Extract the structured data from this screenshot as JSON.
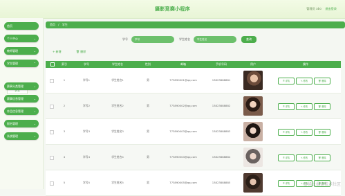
{
  "header": {
    "title": "摄影竞赛小程序",
    "user_label": "管理员 abo",
    "logout_label": "退出登录"
  },
  "sidebar": {
    "items": [
      {
        "label": "首页"
      },
      {
        "label": "个人中心"
      },
      {
        "label": "教师管理"
      },
      {
        "label": "学生管理"
      },
      {
        "label": "赛事分类管理"
      },
      {
        "label": "赛事信息管理"
      },
      {
        "label": "作品信息管理"
      },
      {
        "label": "报名管理"
      },
      {
        "label": "系统管理"
      }
    ],
    "sub_item": "学生"
  },
  "breadcrumb": {
    "home": "首页",
    "sep": "/",
    "current": "学生"
  },
  "search": {
    "field1_label": "学号",
    "field1_placeholder": "学号",
    "field2_label": "学生姓名",
    "field2_placeholder": "学生姓名",
    "button_label": "查询"
  },
  "actions": {
    "add_label": "新增",
    "delete_label": "删除"
  },
  "table": {
    "headers": [
      "",
      "索引",
      "学号",
      "学生姓名",
      "性别",
      "邮箱",
      "手机号码",
      "用户",
      "操作"
    ],
    "rows": [
      {
        "index": "1",
        "sid": "学号1",
        "name": "学生姓名1",
        "gender": "男",
        "email": "773890001@qq.com",
        "phone": "13823888881"
      },
      {
        "index": "2",
        "sid": "学号2",
        "name": "学生姓名2",
        "gender": "男",
        "email": "773890002@qq.com",
        "phone": "13823888882"
      },
      {
        "index": "3",
        "sid": "学号3",
        "name": "学生姓名3",
        "gender": "男",
        "email": "773890003@qq.com",
        "phone": "13823888883"
      },
      {
        "index": "4",
        "sid": "学号4",
        "name": "学生姓名4",
        "gender": "男",
        "email": "773890004@qq.com",
        "phone": "13823888884"
      },
      {
        "index": "5",
        "sid": "学号5",
        "name": "学生姓名5",
        "gender": "男",
        "email": "773890005@qq.com",
        "phone": "13823888885"
      }
    ],
    "row_actions": {
      "detail": "详情",
      "edit": "修改",
      "delete": "删除"
    }
  },
  "watermark": "@稀土掘金技术社区",
  "colors": {
    "accent": "#4cae4c",
    "header_bg": "#e8f5d6"
  }
}
